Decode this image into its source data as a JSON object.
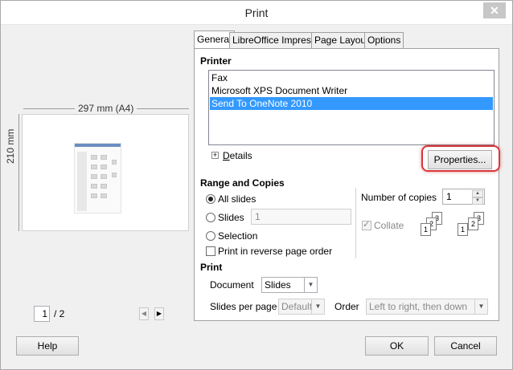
{
  "window": {
    "title": "Print"
  },
  "preview": {
    "paper_size_label": "297 mm (A4)",
    "paper_height_label": "210 mm",
    "page_current": "1",
    "page_total": "/ 2"
  },
  "tabs": [
    {
      "label": "General",
      "active": true
    },
    {
      "label": "LibreOffice Impress",
      "active": false
    },
    {
      "label": "Page Layout",
      "active": false
    },
    {
      "label": "Options",
      "active": false
    }
  ],
  "printer": {
    "section_title": "Printer",
    "items": [
      {
        "label": "Fax",
        "selected": false
      },
      {
        "label": "Microsoft XPS Document Writer",
        "selected": false
      },
      {
        "label": "Send To OneNote 2010",
        "selected": true
      }
    ],
    "details_label": "Details",
    "properties_button": "Properties..."
  },
  "range": {
    "section_title": "Range and Copies",
    "all_slides": "All slides",
    "slides": "Slides",
    "slides_value": "1",
    "selection": "Selection",
    "reverse_order": "Print in reverse page order",
    "copies_label": "Number of copies",
    "copies_value": "1",
    "collate": "Collate"
  },
  "print": {
    "section_title": "Print",
    "document_label": "Document",
    "document_value": "Slides",
    "slides_per_page_label": "Slides per page",
    "slides_per_page_value": "Default",
    "order_label": "Order",
    "order_value": "Left to right, then down"
  },
  "buttons": {
    "help": "Help",
    "ok": "OK",
    "cancel": "Cancel"
  }
}
